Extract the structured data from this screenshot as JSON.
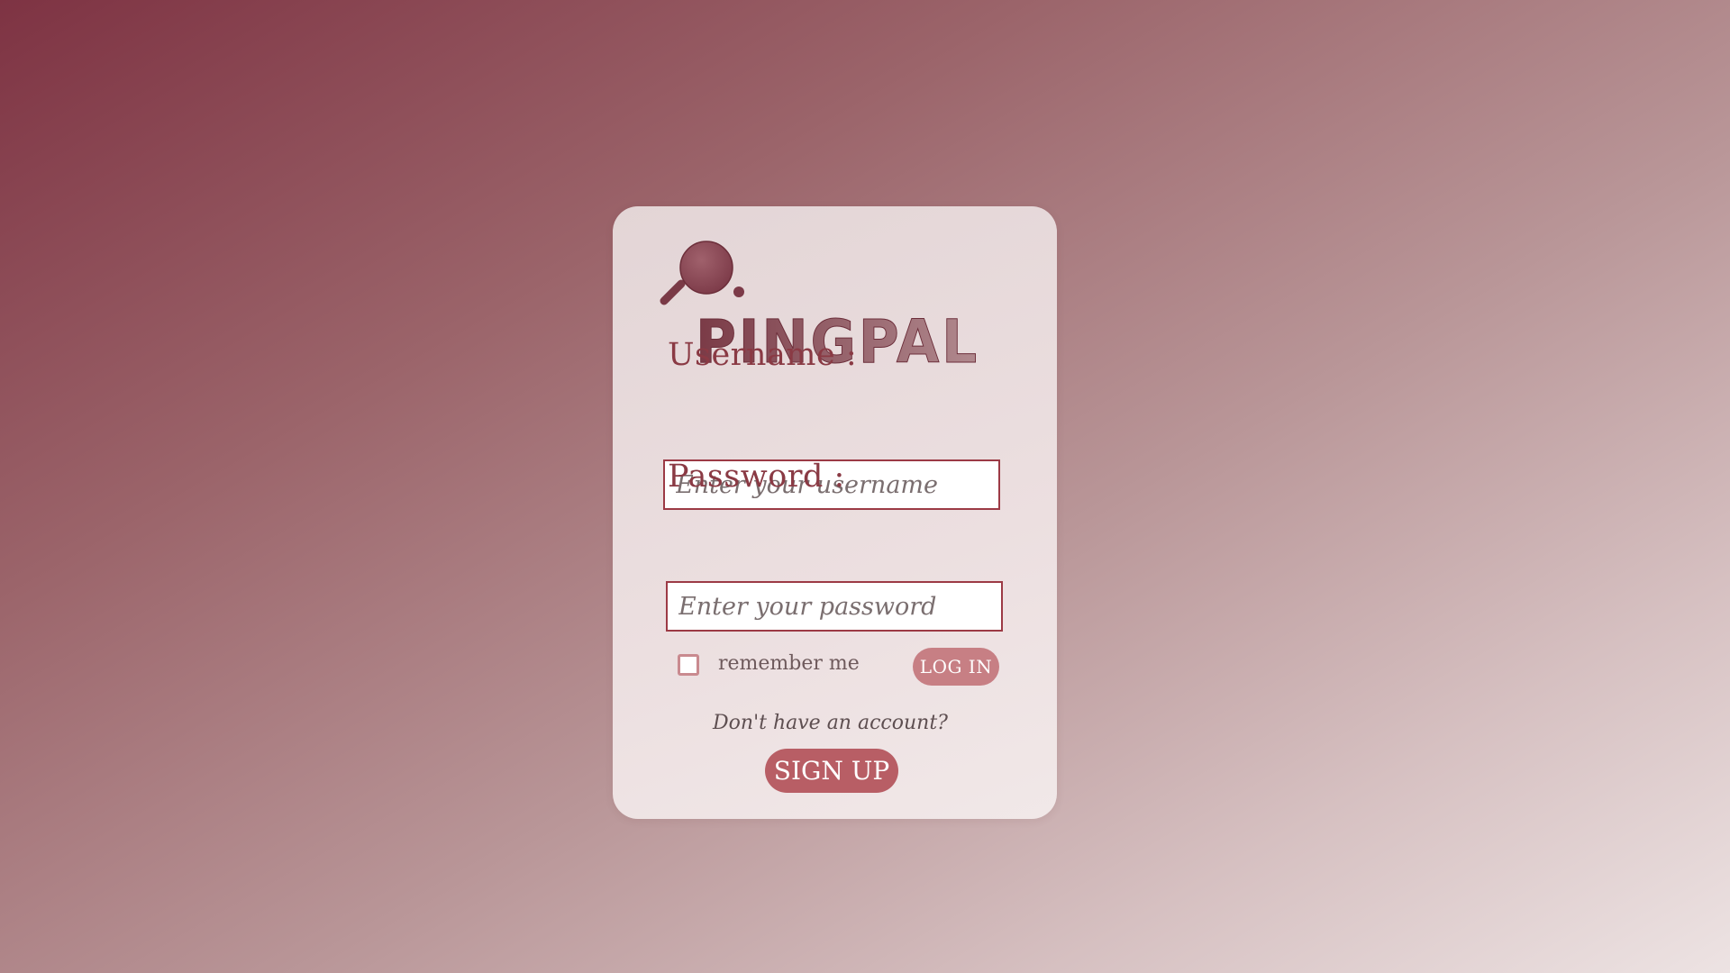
{
  "brand": {
    "name": "PINGPAL",
    "logo_icon": "ping-pong-paddle-icon"
  },
  "login_form": {
    "username_label": "Username :",
    "username_placeholder": "Enter your username",
    "username_value": "",
    "password_label": "Password :",
    "password_placeholder": "Enter your password",
    "password_value": "",
    "remember_label": "remember me",
    "remember_checked": false,
    "login_button": "LOG IN",
    "signup_prompt": "Don't have an account?",
    "signup_button": "SIGN UP"
  },
  "colors": {
    "primary": "#9c3a45",
    "button_light": "#c77f84",
    "button_dark": "#b85e65",
    "label_text": "#8a3a44"
  }
}
